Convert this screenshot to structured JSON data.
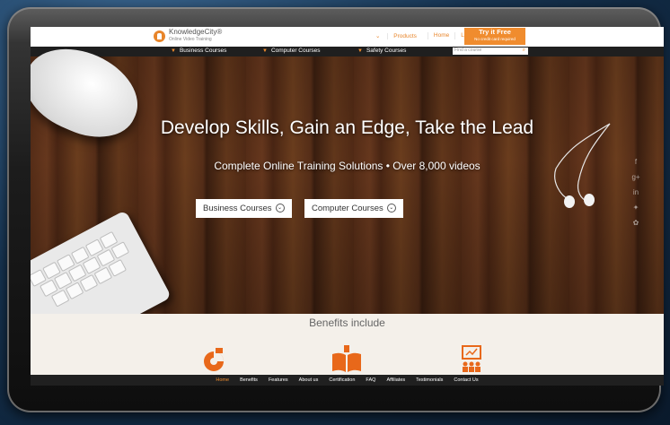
{
  "brand": {
    "name": "KnowledgeCity®",
    "tagline": "Online Video Training",
    "accent": "#f08c2e"
  },
  "top_nav": {
    "products": "Products",
    "home": "Home",
    "login": "Log In",
    "try_free": "Try it Free",
    "try_free_sub": "No credit card required"
  },
  "categories": [
    {
      "label": "Business Courses",
      "icon": "chevron-down-icon"
    },
    {
      "label": "Computer Courses",
      "icon": "chevron-down-icon"
    },
    {
      "label": "Safety Courses",
      "icon": "chevron-down-icon"
    }
  ],
  "search": {
    "placeholder": "Find a course",
    "icon": "search-icon"
  },
  "hero": {
    "title": "Develop Skills, Gain an Edge, Take the Lead",
    "subtitle": "Complete Online Training Solutions • Over 8,000 videos",
    "cta_business": "Business Courses",
    "cta_computer": "Computer Courses"
  },
  "social_icons": [
    "facebook-icon",
    "google-plus-icon",
    "linkedin-icon",
    "twitter-icon",
    "other-social-icon"
  ],
  "benefits": {
    "title": "Benefits include"
  },
  "footer_nav": [
    "Home",
    "Benefits",
    "Features",
    "About us",
    "Certification",
    "FAQ",
    "Affiliates",
    "Testimonials",
    "Contact Us"
  ]
}
